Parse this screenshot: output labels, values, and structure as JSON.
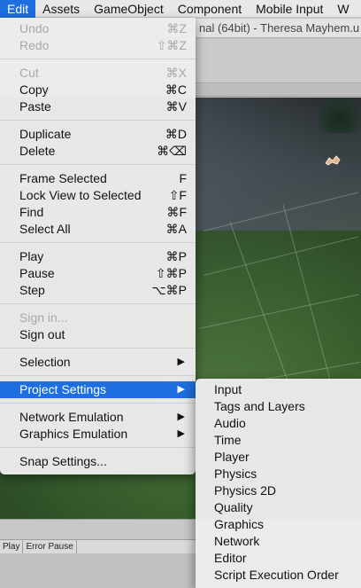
{
  "menubar": {
    "items": [
      "Edit",
      "Assets",
      "GameObject",
      "Component",
      "Mobile Input",
      "W"
    ]
  },
  "window": {
    "title": "nal (64bit) - Theresa Mayhem.u"
  },
  "console": {
    "play_label": "Play",
    "error_pause_label": "Error Pause"
  },
  "edit_menu": {
    "undo": {
      "label": "Undo",
      "shortcut": "⌘Z"
    },
    "redo": {
      "label": "Redo",
      "shortcut": "⇧⌘Z"
    },
    "cut": {
      "label": "Cut",
      "shortcut": "⌘X"
    },
    "copy": {
      "label": "Copy",
      "shortcut": "⌘C"
    },
    "paste": {
      "label": "Paste",
      "shortcut": "⌘V"
    },
    "duplicate": {
      "label": "Duplicate",
      "shortcut": "⌘D"
    },
    "delete": {
      "label": "Delete",
      "shortcut": "⌘⌫"
    },
    "frame_selected": {
      "label": "Frame Selected",
      "shortcut": "F"
    },
    "lock_view": {
      "label": "Lock View to Selected",
      "shortcut": "⇧F"
    },
    "find": {
      "label": "Find",
      "shortcut": "⌘F"
    },
    "select_all": {
      "label": "Select All",
      "shortcut": "⌘A"
    },
    "play": {
      "label": "Play",
      "shortcut": "⌘P"
    },
    "pause": {
      "label": "Pause",
      "shortcut": "⇧⌘P"
    },
    "step": {
      "label": "Step",
      "shortcut": "⌥⌘P"
    },
    "sign_in": {
      "label": "Sign in..."
    },
    "sign_out": {
      "label": "Sign out"
    },
    "selection": {
      "label": "Selection",
      "arrow": "▶"
    },
    "project_settings": {
      "label": "Project Settings",
      "arrow": "▶"
    },
    "network_emulation": {
      "label": "Network Emulation",
      "arrow": "▶"
    },
    "graphics_emulation": {
      "label": "Graphics Emulation",
      "arrow": "▶"
    },
    "snap_settings": {
      "label": "Snap Settings..."
    }
  },
  "project_settings_submenu": {
    "items": [
      "Input",
      "Tags and Layers",
      "Audio",
      "Time",
      "Player",
      "Physics",
      "Physics 2D",
      "Quality",
      "Graphics",
      "Network",
      "Editor",
      "Script Execution Order"
    ]
  },
  "colors": {
    "highlight": "#1d6ede",
    "menu_bg": "#ececec",
    "disabled_text": "#a8a8a8"
  }
}
